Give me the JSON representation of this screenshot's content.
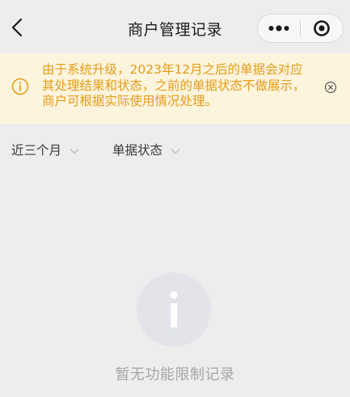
{
  "navbar": {
    "title": "商户管理记录",
    "back_icon": "chevron-left-icon",
    "more_icon": "more-dots-icon",
    "close_icon": "target-circle-icon"
  },
  "notice": {
    "icon": "info-circle-icon",
    "text": "由于系统升级，2023年12月之后的单据会对应其处理结果和状态，之前的单据状态不做展示，商户可根据实际使用情况处理。",
    "close_icon": "close-circle-icon",
    "color": "#e59d18",
    "background": "#fdf4dd"
  },
  "filters": [
    {
      "label": "近三个月",
      "icon": "chevron-down-icon"
    },
    {
      "label": "单据状态",
      "icon": "chevron-down-icon"
    }
  ],
  "empty_state": {
    "icon": "info-i-icon",
    "text": "暂无功能限制记录"
  }
}
